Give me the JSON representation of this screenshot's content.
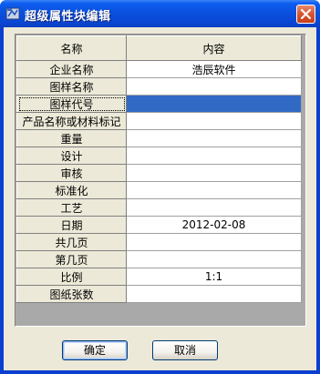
{
  "window": {
    "title": "超级属性块编辑",
    "app_icon": "app-icon",
    "close_icon": "close-icon"
  },
  "grid": {
    "columns": [
      "名称",
      "内容"
    ],
    "rows": [
      {
        "name": "企业名称",
        "value": "浩辰软件"
      },
      {
        "name": "图样名称",
        "value": ""
      },
      {
        "name": "图样代号",
        "value": "",
        "selected": true
      },
      {
        "name": "产品名称或材料标记",
        "value": ""
      },
      {
        "name": "重量",
        "value": ""
      },
      {
        "name": "设计",
        "value": ""
      },
      {
        "name": "审核",
        "value": ""
      },
      {
        "name": "标准化",
        "value": ""
      },
      {
        "name": "工艺",
        "value": ""
      },
      {
        "name": "日期",
        "value": "2012-02-08"
      },
      {
        "name": "共几页",
        "value": ""
      },
      {
        "name": "第几页",
        "value": ""
      },
      {
        "name": "比例",
        "value": "1:1"
      },
      {
        "name": "图纸张数",
        "value": ""
      }
    ]
  },
  "buttons": {
    "ok_label": "确定",
    "cancel_label": "取消"
  },
  "colors": {
    "title_bar": "#0a51de",
    "selection": "#316ac5",
    "dialog_bg": "#ece9d8",
    "close_button": "#d9532d"
  }
}
